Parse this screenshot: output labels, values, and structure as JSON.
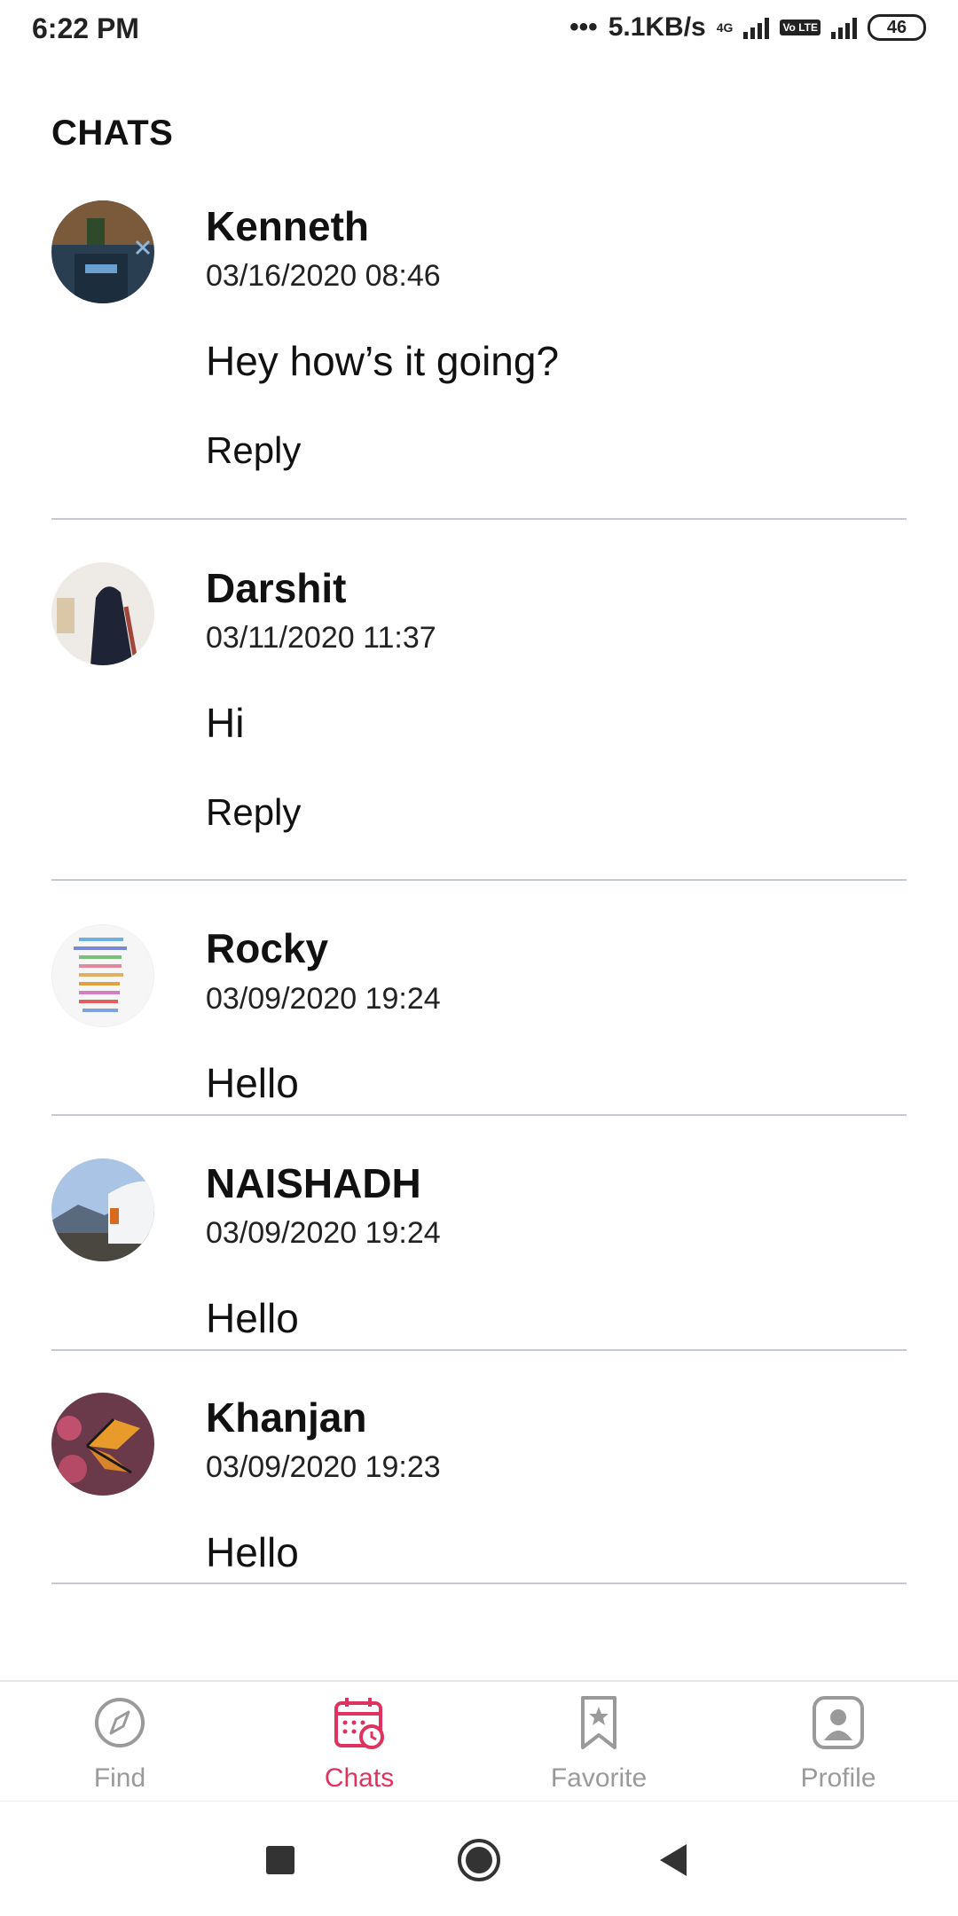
{
  "status_bar": {
    "time": "6:22 PM",
    "network_speed": "5.1KB/s",
    "network_type": "4G",
    "volte": "Vo LTE",
    "battery": "46"
  },
  "header": {
    "title": "CHATS"
  },
  "chats": [
    {
      "name": "Kenneth",
      "timestamp": "03/16/2020 08:46",
      "message": "Hey how’s it going?",
      "reply_label": "Reply"
    },
    {
      "name": "Darshit",
      "timestamp": "03/11/2020 11:37",
      "message": "Hi",
      "reply_label": "Reply"
    },
    {
      "name": "Rocky",
      "timestamp": "03/09/2020 19:24",
      "message": "Hello"
    },
    {
      "name": "NAISHADH",
      "timestamp": "03/09/2020 19:24",
      "message": "Hello"
    },
    {
      "name": "Khanjan",
      "timestamp": "03/09/2020 19:23",
      "message": "Hello"
    }
  ],
  "bottom_nav": {
    "items": [
      {
        "label": "Find",
        "icon": "compass-icon",
        "active": false
      },
      {
        "label": "Chats",
        "icon": "calendar-clock-icon",
        "active": true
      },
      {
        "label": "Favorite",
        "icon": "bookmark-star-icon",
        "active": false
      },
      {
        "label": "Profile",
        "icon": "user-icon",
        "active": false
      }
    ]
  },
  "colors": {
    "accent": "#e0325e",
    "inactive": "#9a9a9a",
    "divider": "#c4c8d0"
  }
}
